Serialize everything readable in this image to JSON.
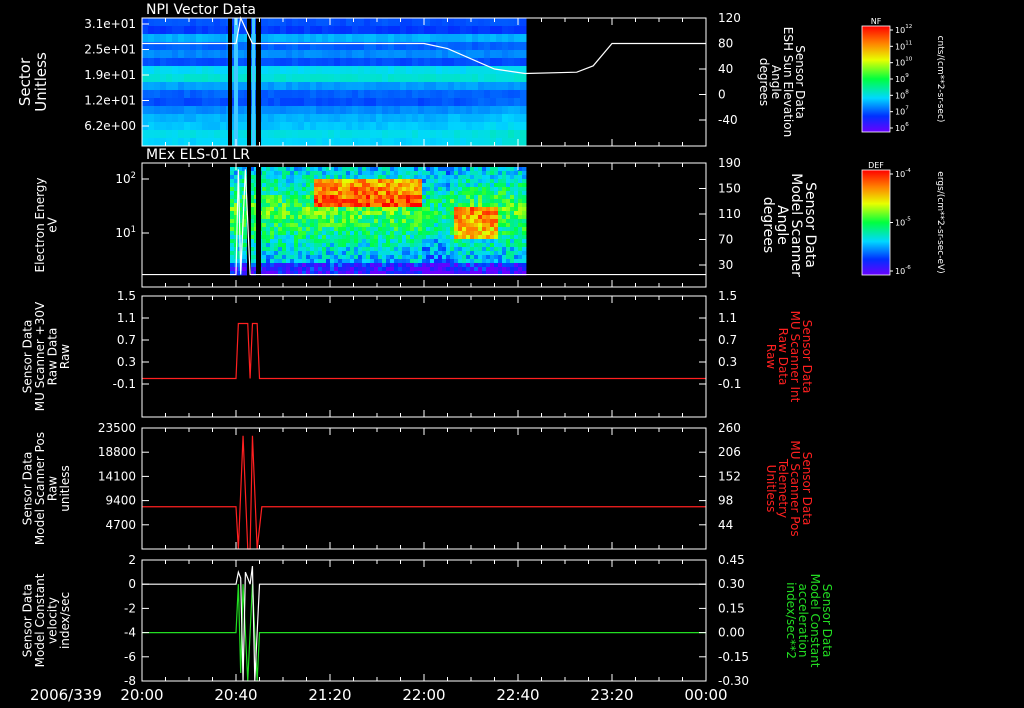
{
  "date_label": "2006/339",
  "time_ticks": [
    "20:00",
    "20:40",
    "21:20",
    "22:00",
    "22:40",
    "23:20",
    "00:00"
  ],
  "time_range_hours": [
    20,
    24
  ],
  "colors": {
    "background": "#000000",
    "axis": "#ffffff",
    "red_series": "#ff2020",
    "green_series": "#22dd22",
    "white_series": "#ffffff"
  },
  "chart_data": [
    {
      "type": "heatmap",
      "panel_title": "NPI Vector Data",
      "ylabel_left": [
        "Sector",
        "Unitless"
      ],
      "ylabel_right": [
        "Sensor Data",
        "ESH Sun Elevation",
        "Angle",
        "degrees"
      ],
      "yticks_left": [
        "3.1e+01",
        "2.5e+01",
        "1.9e+01",
        "1.2e+01",
        "6.2e+00"
      ],
      "yticks_right": [
        "120",
        "80",
        "40",
        "0",
        "-40"
      ],
      "ylim_right": [
        -70,
        120
      ],
      "data_end_time": "22:43",
      "overlay_series": {
        "name": "Sensor Data ESH Sun Elevation Angle",
        "x": [
          "20:00",
          "20:40",
          "20:42",
          "20:47",
          "22:00",
          "22:10",
          "22:30",
          "22:43",
          "23:05",
          "23:12",
          "23:20",
          "00:00"
        ],
        "y": [
          80,
          80,
          120,
          80,
          80,
          72,
          40,
          33,
          35,
          45,
          80,
          80
        ]
      },
      "colorbar": {
        "label": "NF",
        "unit": "cnts/(cm**2-sr-sec)",
        "ticks": [
          "10^12",
          "10^11",
          "10^10",
          "10^9",
          "10^8",
          "10^7",
          "10^6"
        ]
      }
    },
    {
      "type": "heatmap",
      "panel_title": "MEx ELS-01 LR",
      "ylabel_left": [
        "Electron Energy",
        "eV"
      ],
      "ylabel_right": [
        "Sensor Data",
        "Model Scanner",
        "Angle",
        "degrees"
      ],
      "yticks_left": [
        "10^2",
        "10^1"
      ],
      "yticks_right": [
        "190",
        "150",
        "110",
        "70",
        "30"
      ],
      "ylim_right": [
        0,
        190
      ],
      "data_end_time": "22:43",
      "overlay_series": {
        "name": "Sensor Data Model Scanner Angle",
        "x": [
          "20:00",
          "20:40",
          "20:41",
          "20:42",
          "20:44",
          "20:46",
          "20:47",
          "00:00"
        ],
        "y": [
          15,
          15,
          180,
          15,
          180,
          15,
          15,
          15
        ]
      },
      "colorbar": {
        "label": "DEF",
        "unit": "ergs/(cm**2-sr-sec-eV)",
        "ticks": [
          "10^-4",
          "10^-5",
          "10^-6"
        ]
      }
    },
    {
      "type": "line",
      "ylabel_left": [
        "Sensor Data",
        "MU Scanner +30V",
        "Raw Data",
        "Raw"
      ],
      "ylabel_right": [
        "Sensor Data",
        "MU Scanner Int",
        "Raw Data",
        "Raw"
      ],
      "yticks_left": [
        "1.5",
        "1.1",
        "0.7",
        "0.3",
        "-0.1"
      ],
      "yticks_right": [
        "1.5",
        "1.1",
        "0.7",
        "0.3",
        "-0.1"
      ],
      "ylim": [
        -0.3,
        1.5
      ],
      "series": [
        {
          "name": "Sensor Data MU Scanner Int Raw Data",
          "color": "red",
          "x": [
            "20:00",
            "20:40",
            "20:41",
            "20:45",
            "20:46",
            "20:47",
            "20:49",
            "20:50",
            "00:00"
          ],
          "y": [
            0,
            0,
            1,
            1,
            0,
            1,
            1,
            0,
            0
          ]
        }
      ]
    },
    {
      "type": "line",
      "ylabel_left": [
        "Sensor Data",
        "Model Scanner Pos",
        "Raw",
        "unitless"
      ],
      "ylabel_right": [
        "Sensor Data",
        "MU Scanner Pos",
        "Telemetry",
        "Unitless"
      ],
      "yticks_left": [
        "23500",
        "18800",
        "14100",
        "9400",
        "4700"
      ],
      "yticks_right": [
        "260",
        "206",
        "152",
        "98",
        "44"
      ],
      "ylim": [
        0,
        23500
      ],
      "series": [
        {
          "name": "Sensor Data MU Scanner Pos Telemetry",
          "color": "red",
          "x": [
            "20:00",
            "20:40",
            "20:41",
            "20:43",
            "20:45",
            "20:46",
            "20:47",
            "20:49",
            "20:51",
            "00:00"
          ],
          "y": [
            8200,
            8200,
            0,
            22000,
            0,
            0,
            22000,
            0,
            8200,
            8200
          ]
        }
      ]
    },
    {
      "type": "line",
      "ylabel_left": [
        "Sensor Data",
        "Model Constant",
        "velocity",
        "index/sec"
      ],
      "ylabel_right": [
        "Sensor Data",
        "Model Constant",
        "acceleration",
        "index/sec**2"
      ],
      "yticks_left": [
        "2",
        "0",
        "-2",
        "-4",
        "-6",
        "-8"
      ],
      "yticks_right": [
        "0.45",
        "0.30",
        "0.15",
        "0.00",
        "-0.15",
        "-0.30"
      ],
      "ylim_left": [
        -8,
        2
      ],
      "ylim_right": [
        -0.3,
        0.45
      ],
      "series": [
        {
          "name": "Sensor Data Model Constant velocity",
          "color": "white",
          "x": [
            "20:00",
            "20:40",
            "20:41",
            "20:42",
            "20:43",
            "20:44",
            "20:46",
            "20:47",
            "20:48",
            "20:50",
            "00:00"
          ],
          "y": [
            0,
            0,
            1,
            0.5,
            -8,
            1,
            0,
            1.5,
            -8,
            0,
            0
          ]
        },
        {
          "name": "Sensor Data Model Constant acceleration",
          "color": "green",
          "x": [
            "20:00",
            "20:40",
            "20:41",
            "20:42",
            "20:43",
            "20:45",
            "20:46",
            "20:47",
            "20:49",
            "20:50",
            "00:00"
          ],
          "y": [
            0,
            0,
            0.3,
            -0.25,
            0.3,
            -0.3,
            0,
            0.3,
            -0.3,
            0,
            0
          ]
        }
      ]
    }
  ]
}
